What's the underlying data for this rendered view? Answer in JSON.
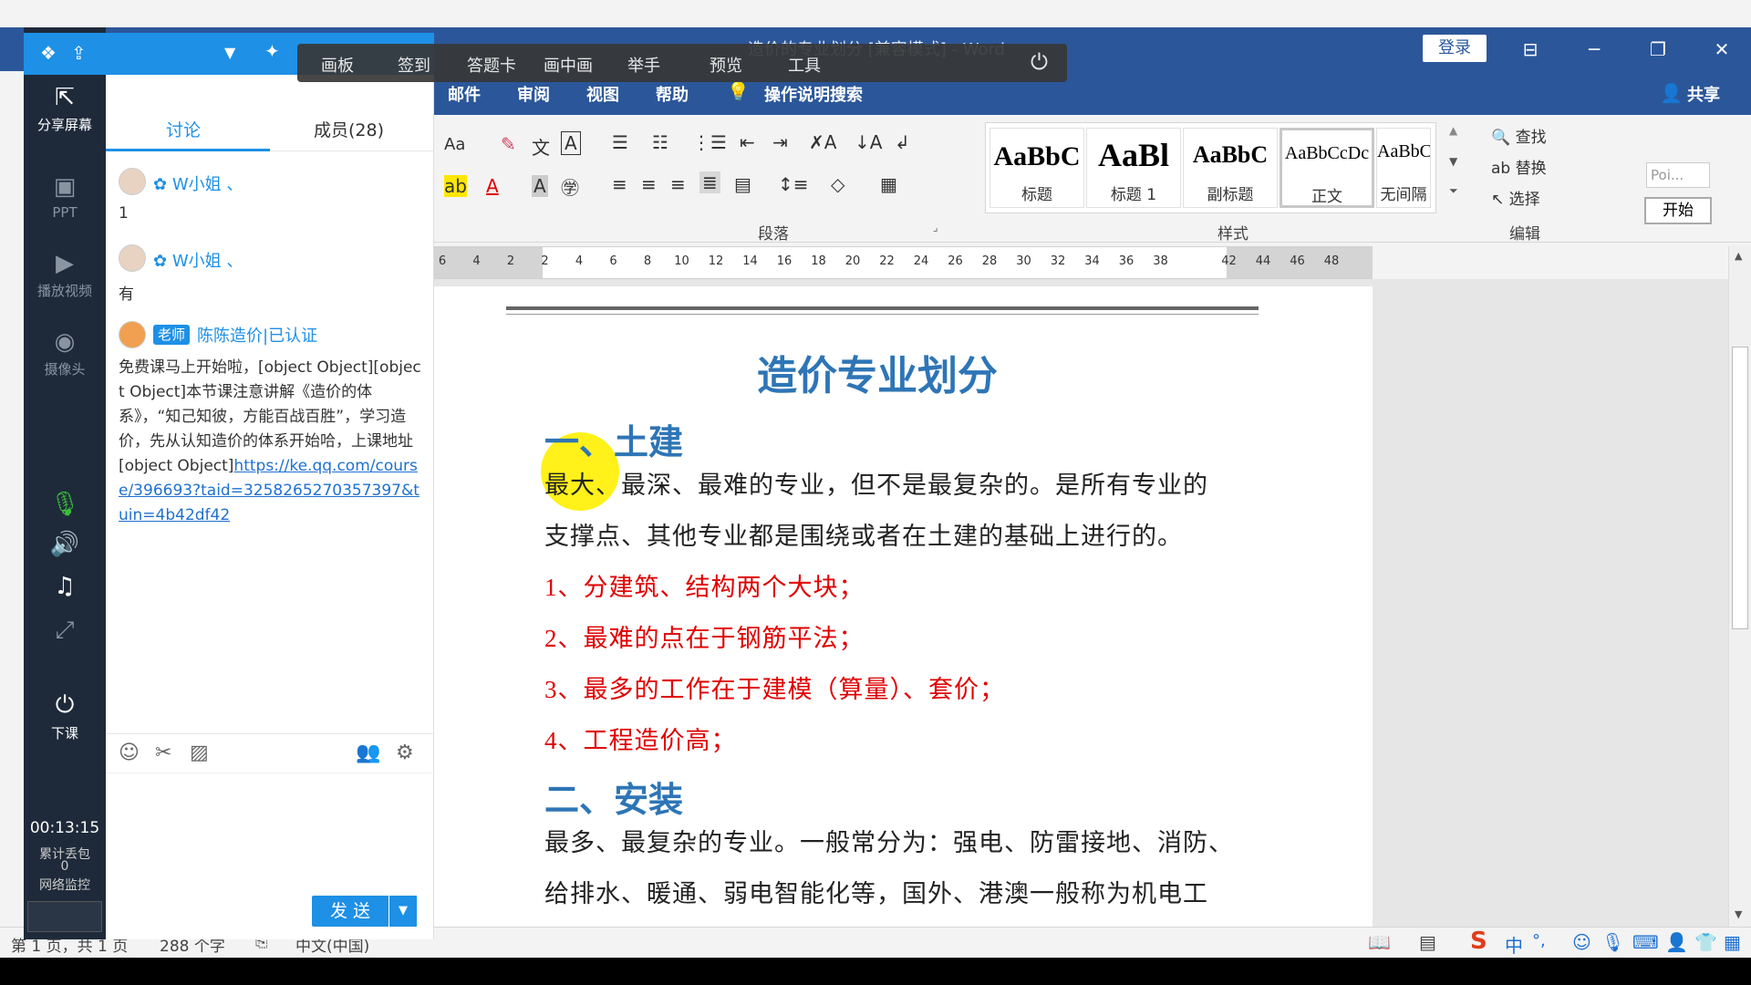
{
  "word": {
    "doc_title": "造价的专业划分 [兼容模式] - Word",
    "login": "登录",
    "share": "共享",
    "tabs": [
      "邮件",
      "审阅",
      "视图",
      "帮助"
    ],
    "tell_me": "操作说明搜索",
    "groups": {
      "paragraph": "段落",
      "styles": "样式",
      "editing": "编辑"
    },
    "styles": [
      {
        "preview": "AaBbC",
        "name": "标题"
      },
      {
        "preview": "AaBl",
        "name": "标题 1"
      },
      {
        "preview": "AaBbC",
        "name": "副标题"
      },
      {
        "preview": "AaBbCcDc",
        "name": "正文"
      },
      {
        "preview": "AaBbCcDc",
        "name": "无间隔"
      }
    ],
    "edit": {
      "find": "查找",
      "replace": "替换",
      "select": "选择"
    },
    "side_input": "Poi...",
    "side_start": "开始",
    "font_size_label": "Aa",
    "ruler_ticks": [
      "6",
      "4",
      "2",
      "2",
      "4",
      "6",
      "8",
      "10",
      "12",
      "14",
      "16",
      "18",
      "20",
      "22",
      "24",
      "26",
      "28",
      "30",
      "32",
      "34",
      "36",
      "38",
      "42",
      "44",
      "46",
      "48"
    ],
    "doc": {
      "heading": "造价专业划分",
      "section1": "一、土建",
      "p1_line1": "最大、最深、最难的专业，但不是最复杂的。是所有专业的",
      "p1_line2": "支撑点、其他专业都是围绕或者在土建的基础上进行的。",
      "list": [
        "1、分建筑、结构两个大块；",
        "2、最难的点在于钢筋平法；",
        "3、最多的工作在于建模（算量）、套价；",
        "4、工程造价高；"
      ],
      "section2": "二、安装",
      "p2_line1": "最多、最复杂的专业。一般常分为：强电、防雷接地、消防、",
      "p2_line2": "给排水、暖通、弱电智能化等，国外、港澳一般称为机电工"
    },
    "status": {
      "page": "第 1 页，共 1 页",
      "words": "288 个字",
      "lang": "中文(中国)"
    }
  },
  "classroom": {
    "sidebar": [
      {
        "label": "分享屏幕",
        "icon": "share-screen-icon"
      },
      {
        "label": "PPT",
        "icon": "ppt-icon"
      },
      {
        "label": "播放视频",
        "icon": "play-video-icon"
      },
      {
        "label": "摄像头",
        "icon": "camera-icon"
      },
      {
        "label": "下课",
        "icon": "end-class-icon"
      }
    ],
    "timer": "00:13:15",
    "lost_packets_label": "累计丢包",
    "lost_packets": "0",
    "network_label": "网络监控",
    "tabs": {
      "discussion": "讨论",
      "members": "成员(28)"
    },
    "messages": [
      {
        "name": "W小姐 、",
        "text": "1"
      },
      {
        "name": "W小姐 、",
        "text": "有"
      }
    ],
    "teacher_badge": "老师",
    "teacher_name": "陈陈造价|已认证",
    "teacher_msg": "免费课马上开始啦，[object Object][object Object]本节课注意讲解《造价的体系》，“知己知彼，方能百战百胜”，学习造价，先从认知造价的体系开始哈，上课地址[object Object]",
    "teacher_link": "https://ke.qq.com/course/396693?taid=3258265270357397&tuin=4b42df42",
    "send": "发 送"
  },
  "floatbar": [
    "画板",
    "签到",
    "答题卡",
    "画中画",
    "举手",
    "预览",
    "工具"
  ],
  "colors": {
    "word_blue": "#2b579a",
    "heading_blue": "#2e75b6",
    "list_red": "#e00000",
    "classroom_blue": "#1e90e6"
  }
}
